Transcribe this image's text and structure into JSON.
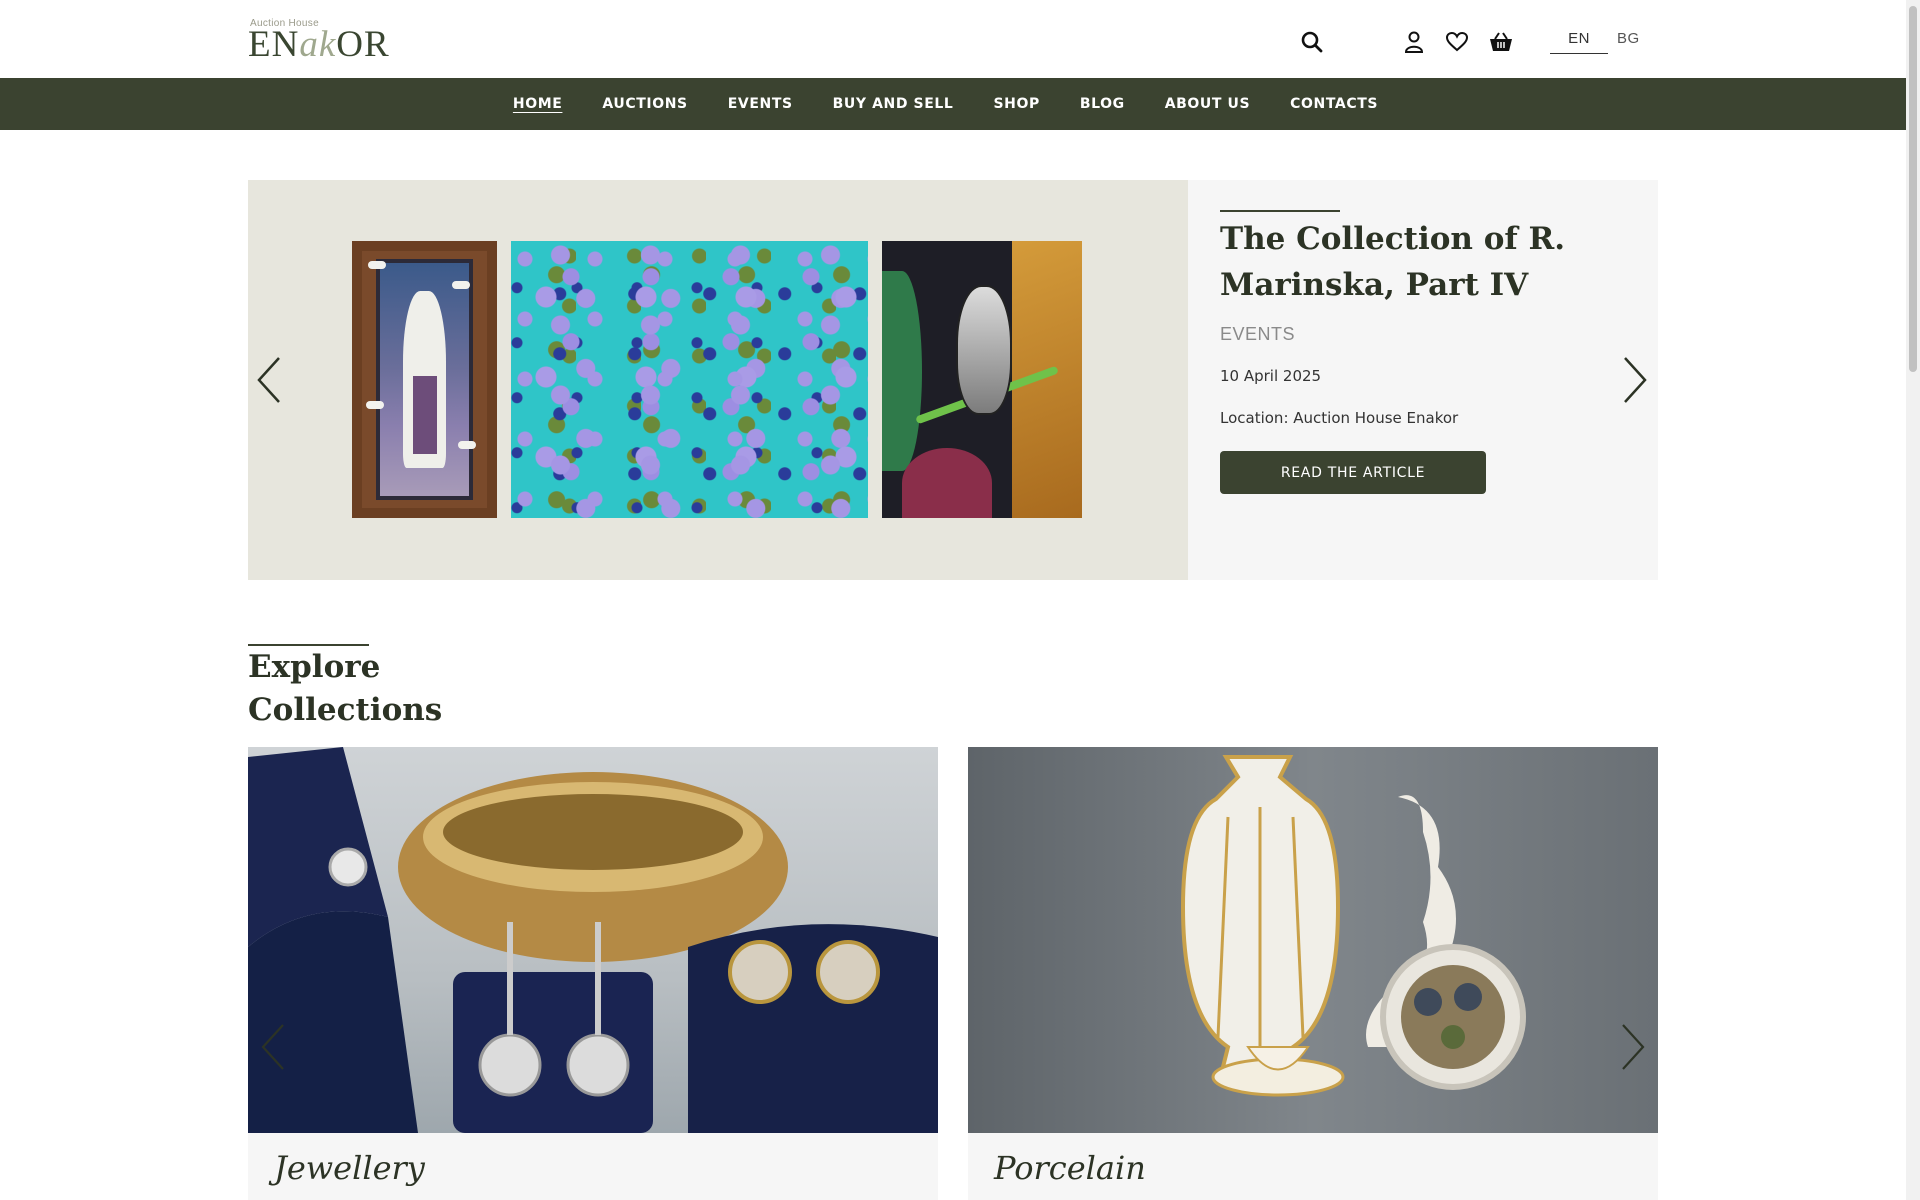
{
  "logo": {
    "small": "Auction House",
    "big_left": "EN",
    "big_mid": "ak",
    "big_right": "OR"
  },
  "header_icons": [
    "search-icon",
    "user-icon",
    "heart-icon",
    "basket-icon"
  ],
  "languages": {
    "active": "EN",
    "other": "BG"
  },
  "nav": [
    {
      "label": "HOME"
    },
    {
      "label": "AUCTIONS"
    },
    {
      "label": "EVENTS"
    },
    {
      "label": "BUY AND SELL"
    },
    {
      "label": "SHOP"
    },
    {
      "label": "BLOG"
    },
    {
      "label": "ABOUT US"
    },
    {
      "label": "CONTACTS"
    }
  ],
  "hero": {
    "title": "The Collection of R. Marinska, Part IV",
    "category": "EVENTS",
    "date": "10 April 2025",
    "location": "Location: Auction House Enakor",
    "button": "READ THE ARTICLE"
  },
  "explore": {
    "title": "Explore Collections"
  },
  "collections": [
    {
      "name": "Jewellery"
    },
    {
      "name": "Porcelain"
    }
  ],
  "colors": {
    "brand_dark": "#3b4330",
    "hero_bg": "#e7e6dd",
    "panel_bg": "#f6f6f6"
  }
}
